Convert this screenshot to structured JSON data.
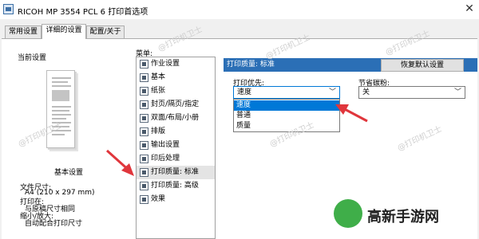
{
  "window": {
    "title": "RICOH MP 3554 PCL 6 打印首选项",
    "close_glyph": "✕"
  },
  "tabs": [
    {
      "label": "常用设置"
    },
    {
      "label": "详细的设置"
    },
    {
      "label": "配置/关于"
    }
  ],
  "left": {
    "current_settings_label": "当前设置",
    "basic_settings_label": "基本设置",
    "info": [
      "文件尺寸:",
      "A4 (210 x 297 mm)",
      "打印在:",
      "与原稿尺寸相同",
      "缩小/放大:",
      "自动配合打印尺寸"
    ]
  },
  "menu": {
    "label": "菜单:",
    "items": [
      {
        "label": "作业设置",
        "icon": "job-settings-icon"
      },
      {
        "label": "基本",
        "icon": "basic-icon"
      },
      {
        "label": "纸张",
        "icon": "paper-icon"
      },
      {
        "label": "封页/隔页/指定",
        "icon": "cover-icon"
      },
      {
        "label": "双面/布局/小册",
        "icon": "duplex-icon"
      },
      {
        "label": "排版",
        "icon": "layout-icon"
      },
      {
        "label": "输出设置",
        "icon": "output-icon"
      },
      {
        "label": "印后处理",
        "icon": "finishing-icon"
      },
      {
        "label": "打印质量: 标准",
        "icon": "print-quality-icon",
        "selected": true
      },
      {
        "label": "打印质量: 高级",
        "icon": "print-quality-advanced-icon"
      },
      {
        "label": "效果",
        "icon": "effects-icon"
      }
    ]
  },
  "section": {
    "header": "打印质量: 标准",
    "reset_button": "恢复默认设置",
    "print_priority": {
      "label": "打印优先:",
      "value": "速度",
      "options": [
        "速度",
        "普通",
        "质量"
      ],
      "highlighted": "速度"
    },
    "toner_saving": {
      "label": "节省碳粉:",
      "value": "关"
    }
  },
  "watermark_text": "@打印机卫士",
  "logo": {
    "text": "高新手游网"
  },
  "colors": {
    "accent": "#2b6fb6",
    "highlight": "#0078d7",
    "arrow": "#e0363c",
    "logo_green": "#3fae49"
  }
}
